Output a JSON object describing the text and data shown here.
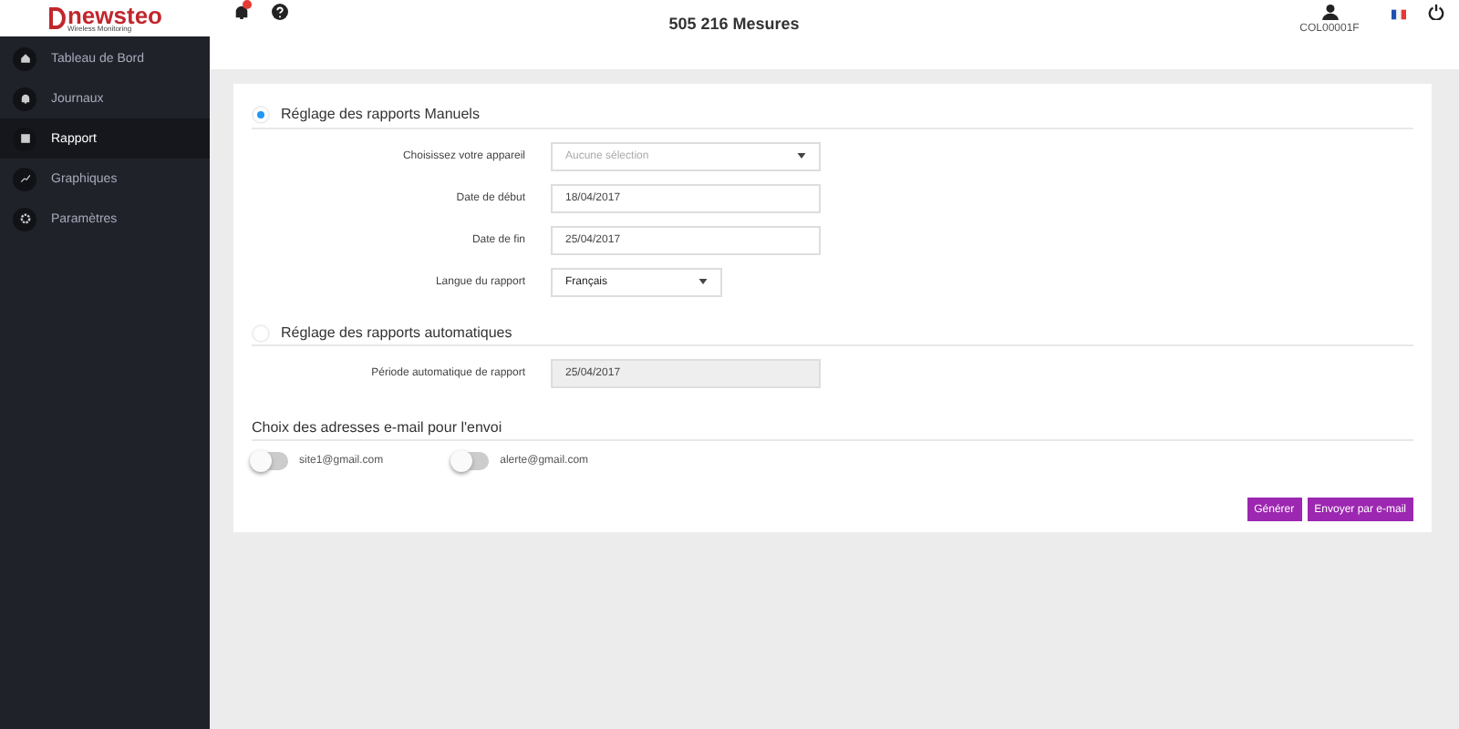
{
  "logo": {
    "text": "newsteo",
    "tagline": "Wireless Monitoring"
  },
  "sidebar": {
    "items": [
      {
        "label": "Tableau de Bord",
        "kind": "home",
        "selected": false
      },
      {
        "label": "Journaux",
        "kind": "bell",
        "selected": false
      },
      {
        "label": "Rapport",
        "kind": "report",
        "selected": true
      },
      {
        "label": "Graphiques",
        "kind": "chart",
        "selected": false
      },
      {
        "label": "Paramètres",
        "kind": "gear",
        "selected": false
      }
    ]
  },
  "header": {
    "title": "505 216 Mesures",
    "user": "COL00001F",
    "notifications": true
  },
  "manual": {
    "title": "Réglage des rapports Manuels",
    "selected": true,
    "fields": [
      {
        "kind": "select",
        "label": "Choisissez votre appareil",
        "placeholder": "Aucune sélection"
      },
      {
        "kind": "input",
        "label": "Date de début",
        "value": "18/04/2017"
      },
      {
        "kind": "input",
        "label": "Date de fin",
        "value": "25/04/2017"
      },
      {
        "kind": "dropdown",
        "label": "Langue du rapport",
        "value": "Français"
      }
    ]
  },
  "automatic": {
    "title": "Réglage des rapports automatiques",
    "selected": false,
    "fields": [
      {
        "kind": "input",
        "label": "Période automatique de rapport",
        "value": "25/04/2017",
        "disabled": true
      }
    ]
  },
  "emails": {
    "title": "Choix des adresses e-mail pour l'envoi",
    "items": [
      {
        "address": "site1@gmail.com",
        "on": false
      },
      {
        "address": "alerte@gmail.com",
        "on": false
      }
    ]
  },
  "buttons": [
    "Générer",
    "Envoyer par e-mail"
  ]
}
